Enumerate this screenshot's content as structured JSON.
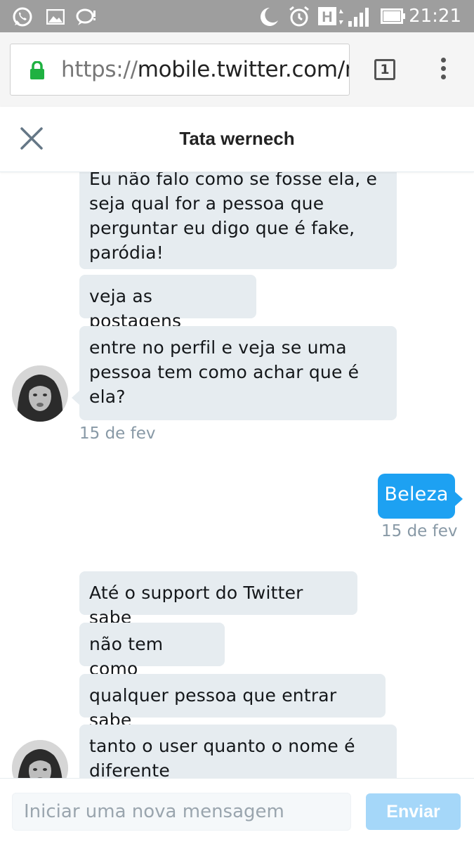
{
  "status_bar": {
    "time": "21:21",
    "network_letter": "H",
    "icons": [
      "whatsapp-icon",
      "gallery-icon",
      "messenger-icon",
      "moon-icon",
      "alarm-icon",
      "signal-icon",
      "battery-icon"
    ]
  },
  "browser": {
    "url_scheme": "https://",
    "url_host": "mobile.twitter.com/m",
    "tab_count": "1",
    "lock_color": "#1fb141"
  },
  "conversation": {
    "title": "Tata wernech",
    "messages": [
      {
        "direction": "received",
        "text": "Eu não falo como se fosse ela, e seja qual for a pessoa que perguntar eu digo que é fake, paródia!"
      },
      {
        "direction": "received",
        "text": "veja as postagens"
      },
      {
        "direction": "received",
        "text": "entre no perfil e veja se uma pessoa tem como achar que é ela?"
      },
      {
        "direction": "received",
        "timestamp": "15 de fev"
      },
      {
        "direction": "sent",
        "text": "Beleza"
      },
      {
        "direction": "sent",
        "timestamp": "15 de fev"
      },
      {
        "direction": "received",
        "text": "Até o support do Twitter sabe"
      },
      {
        "direction": "received",
        "text": "não tem como"
      },
      {
        "direction": "received",
        "text": "qualquer pessoa que entrar sabe"
      },
      {
        "direction": "received",
        "text": "tanto o user quanto o nome é diferente"
      }
    ]
  },
  "composer": {
    "placeholder": "Iniciar uma nova mensagem",
    "send_label": "Enviar"
  },
  "colors": {
    "received_bubble": "#e6ecf0",
    "sent_bubble": "#1da1f2",
    "send_button_disabled": "#a5d7f9",
    "status_bar": "#9e9e9e"
  }
}
